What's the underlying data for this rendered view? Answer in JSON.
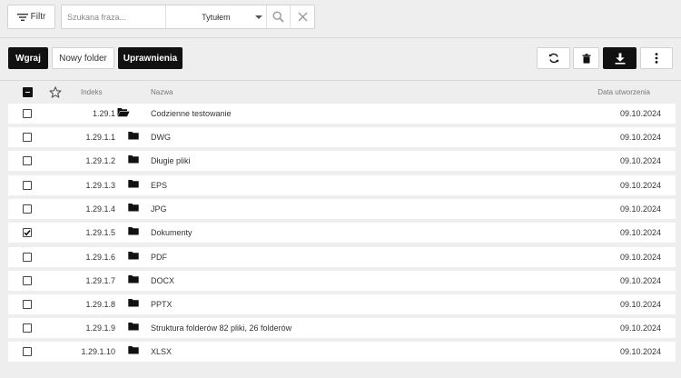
{
  "toolbar_top": {
    "filter_label": "Filtr",
    "search_placeholder": "Szukana fraza...",
    "search_value": "",
    "field_selected": "Tytułem"
  },
  "actions": {
    "upload": "Wgraj",
    "new_folder": "Nowy folder",
    "permissions": "Uprawnienia"
  },
  "columns": {
    "index": "Indeks",
    "name": "Nazwa",
    "date": "Data utworzenia"
  },
  "rows": [
    {
      "index": "1.29.1",
      "name": "Codzienne testowanie",
      "date": "09.10.2024",
      "checked": false,
      "open": true
    },
    {
      "index": "1.29.1.1",
      "name": "DWG",
      "date": "09.10.2024",
      "checked": false,
      "open": false
    },
    {
      "index": "1.29.1.2",
      "name": "Długie pliki",
      "date": "09.10.2024",
      "checked": false,
      "open": false
    },
    {
      "index": "1.29.1.3",
      "name": "EPS",
      "date": "09.10.2024",
      "checked": false,
      "open": false
    },
    {
      "index": "1.29.1.4",
      "name": "JPG",
      "date": "09.10.2024",
      "checked": false,
      "open": false
    },
    {
      "index": "1.29.1.5",
      "name": "Dokumenty",
      "date": "09.10.2024",
      "checked": true,
      "open": false
    },
    {
      "index": "1.29.1.6",
      "name": "PDF",
      "date": "09.10.2024",
      "checked": false,
      "open": false
    },
    {
      "index": "1.29.1.7",
      "name": "DOCX",
      "date": "09.10.2024",
      "checked": false,
      "open": false
    },
    {
      "index": "1.29.1.8",
      "name": "PPTX",
      "date": "09.10.2024",
      "checked": false,
      "open": false
    },
    {
      "index": "1.29.1.9",
      "name": "Struktura folderów 82 pliki, 26 folderów",
      "date": "09.10.2024",
      "checked": false,
      "open": false
    },
    {
      "index": "1.29.1.10",
      "name": "XLSX",
      "date": "09.10.2024",
      "checked": false,
      "open": false
    }
  ],
  "icons": {
    "filter": "filter-icon",
    "search": "search-icon",
    "clear": "close-icon",
    "refresh": "refresh-icon",
    "delete": "trash-icon",
    "download": "download-icon",
    "more": "more-vert-icon",
    "star": "star-outline-icon",
    "folder": "folder-icon",
    "folder_open": "folder-open-icon"
  }
}
